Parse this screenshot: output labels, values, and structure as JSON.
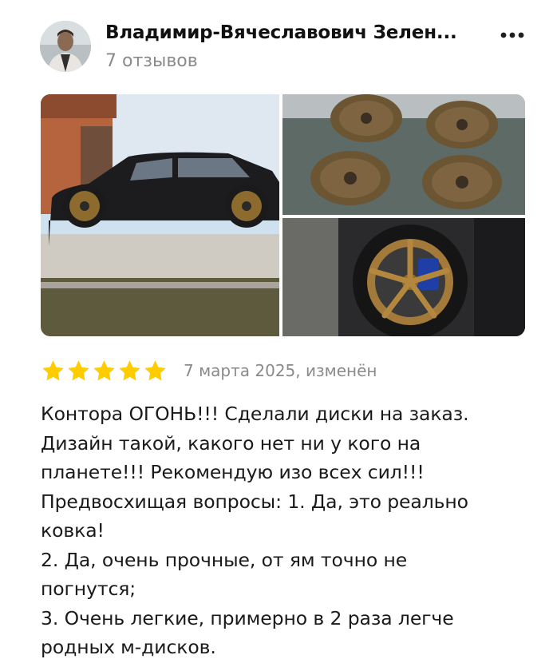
{
  "author": {
    "name": "Владимир-Вячеславович Зелен...",
    "reviews_count": "7 отзывов",
    "avatar_icon": "person-avatar"
  },
  "menu": {
    "icon": "more-dots-icon"
  },
  "photos": [
    {
      "subject": "black SUV with bronze wheels parked outside"
    },
    {
      "subject": "four bronze wheel rims on the ground"
    },
    {
      "subject": "close-up of bronze wheel with blue brake caliper"
    }
  ],
  "rating": {
    "stars": 5,
    "max": 5,
    "color": "#FFCC00"
  },
  "review": {
    "date": "7 марта 2025, изменён",
    "lines": [
      "Контора ОГОНЬ!!! Сделали диски на заказ.",
      "Дизайн такой, какого нет ни у кого на",
      "планете!!! Рекомендую изо всех сил!!!",
      "Предвосхищая вопросы: 1. Да, это реально",
      "ковка!",
      "2. Да, очень прочные, от ям точно не",
      "погнутся;",
      "3. Очень легкие, примерно в 2 раза легче",
      "родных м-дисков."
    ]
  }
}
